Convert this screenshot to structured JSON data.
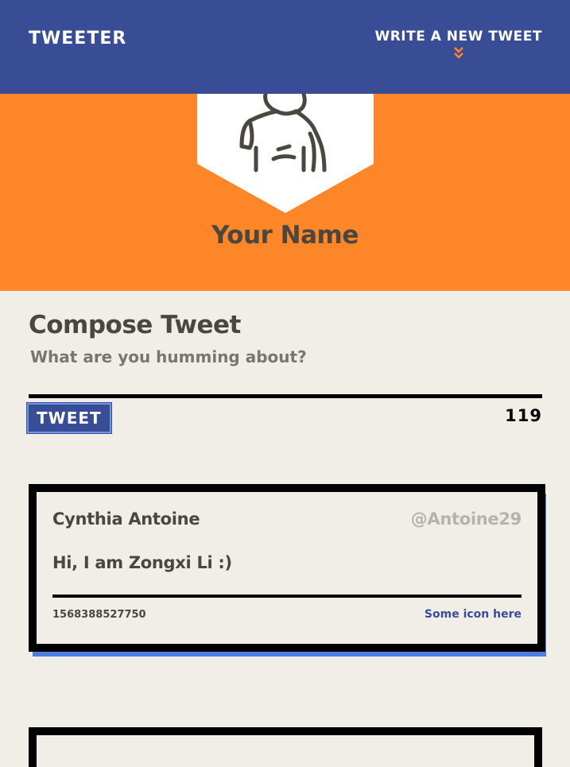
{
  "navbar": {
    "brand": "TWEETER",
    "compose_toggle_label": "WRITE A NEW TWEET",
    "toggle_icon": "double-chevron-down-icon"
  },
  "profile": {
    "name": "Your Name",
    "avatar_icon": "user-avatar-icon"
  },
  "compose": {
    "title": "Compose Tweet",
    "placeholder": "What are you humming about?",
    "value": "",
    "submit_label": "TWEET",
    "counter": "119"
  },
  "tweets": [
    {
      "author": "Cynthia Antoine",
      "handle": "@Antoine29",
      "content": "Hi, I am Zongxi Li :)",
      "timestamp": "1568388527750",
      "icons_label": "Some icon here"
    }
  ],
  "colors": {
    "navbar": "#394d96",
    "hero": "#fd8629",
    "page_background": "#f1eee8",
    "card_shadow": "#4f7de2",
    "text": "#4a4740"
  }
}
